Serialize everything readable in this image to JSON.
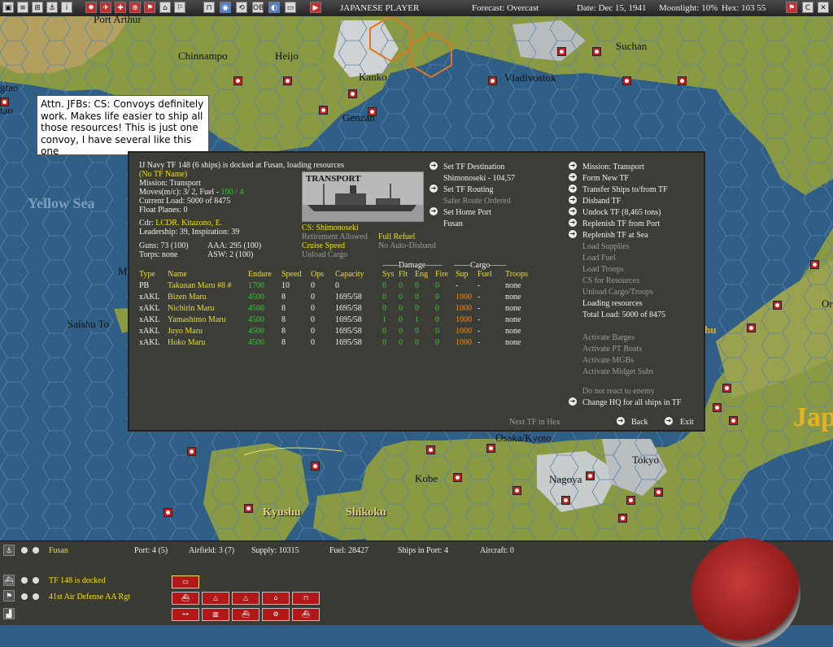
{
  "toolbar": {
    "player": "JAPANESE PLAYER",
    "forecast": "Forecast: Overcast",
    "date": "Date: Dec 15, 1941",
    "moonlight": "Moonlight: 10%",
    "hex": "Hex: 103 55",
    "icons": [
      "map-icon",
      "report-icon",
      "group-icon",
      "ship-icon",
      "info-icon",
      "flag-icon",
      "plane-icon",
      "unit-icon",
      "target-icon",
      "weather-icon",
      "base-icon",
      "globe-icon",
      "replay-icon",
      "ob-icon",
      "save-icon",
      "play-icon"
    ],
    "right_icons": [
      "map-toggle-icon",
      "c-icon",
      "x-icon"
    ]
  },
  "map_labels": {
    "port_arthur": "Port Arthur",
    "chinnampo": "Chinnampo",
    "heijo": "Heijo",
    "kanko": "Kanko",
    "suchan": "Suchan",
    "vladivostok": "Vladivostok",
    "genzan": "Genzan",
    "tao": "gtao",
    "tao2": "tao",
    "yellow_sea": "Yellow Sea",
    "saishu_to": "Saishu To",
    "osaka": "Osaka/Kyoto",
    "kobe": "Kobe",
    "nagoya": "Nagoya",
    "tokyo": "Tokyo",
    "kyushu": "Kyushu",
    "shikoku": "Shikoku",
    "japan": "Jap",
    "m": "M",
    "hu": "hu",
    "or": "Or"
  },
  "note": "Attn. JFBs:   CS: Convoys definitely work.  Makes life easier to ship all those resources!  This is just one convoy, I have several like this one",
  "tf": {
    "header": "IJ Navy TF 148 (6 ships) is docked at Fusan, loading resources",
    "no_tf_name": "(No TF Name)",
    "mission": "Mission:  Transport",
    "moves_label": "Moves(m/c): 3/ 2, Fuel - ",
    "moves_fuel": "100 / 4",
    "current_load": "Current Load:  5000 of 8475",
    "float_planes": "Float Planes: 0",
    "cdr_label": "Cdr:  ",
    "cdr_name": "LCDR. Kitazono, E.",
    "leadership": "Leadership: 39, Inspiration: 39",
    "guns": "Guns: 73 (100)",
    "aaa": "AAA: 295 (100)",
    "torps": "Torps: none",
    "asw": "ASW: 2 (100)",
    "photo_label": "TRANSPORT",
    "cs": "CS: Shimonoseki",
    "retirement": "Retirement Allowed",
    "full_refuel": "Full Refuel",
    "cruise_speed": "Cruise Speed",
    "no_auto_disband": "No Auto-Disband",
    "unload_cargo": "Unload Cargo"
  },
  "middle_menu": {
    "set_destination": "Set TF Destination",
    "destination_value": "Shimonoseki - 104,57",
    "set_routing": "Set TF Routing",
    "routing_value": "Safer Route Ordered",
    "set_home": "Set Home Port",
    "home_value": "Fusan"
  },
  "right_menu": {
    "mission": "Mission: Transport",
    "form_new": "Form New TF",
    "transfer": "Transfer Ships to/from TF",
    "disband": "Disband TF",
    "undock": "Undock TF (8,465 tons)",
    "replenish_port": "Replenish TF from Port",
    "replenish_sea": "Replenish TF at Sea",
    "load_supplies": "Load Supplies",
    "load_fuel": "Load Fuel",
    "load_troops": "Load Troops",
    "cs_resources": "CS for Resources",
    "unload": "Unload Cargo/Troops",
    "loading_resources": "Loading resources",
    "total_load": "Total Load: 5000 of 8475",
    "barges": "Activate Barges",
    "pt_boats": "Activate PT Boats",
    "mgbs": "Activate MGBs",
    "midget": "Activate Midget Subs",
    "no_react": "Do not react to enemy",
    "change_hq": "Change HQ for all ships in TF",
    "next_tf": "Next TF in Hex",
    "back": "Back",
    "exit": "Exit"
  },
  "ship_table": {
    "group_damage": "Damage",
    "group_cargo": "Cargo",
    "headers": [
      "Type",
      "Name",
      "Endure",
      "Speed",
      "Ops",
      "Capacity",
      "Sys",
      "Flt",
      "Eng",
      "Fire",
      "Sup",
      "Fuel",
      "Troops"
    ],
    "rows": [
      [
        "PB",
        "Takunan Maru #8 #",
        "1700",
        "10",
        "0",
        "0",
        "0",
        "0",
        "0",
        "0",
        "-",
        "-",
        "none"
      ],
      [
        "xAKL",
        "Bizen Maru",
        "4500",
        "8",
        "0",
        "1695/58",
        "0",
        "0",
        "0",
        "0",
        "1000",
        "-",
        "none"
      ],
      [
        "xAKL",
        "Nichirin Maru",
        "4500",
        "8",
        "0",
        "1695/58",
        "0",
        "0",
        "0",
        "0",
        "1000",
        "-",
        "none"
      ],
      [
        "xAKL",
        "Yamashimo Maru",
        "4500",
        "8",
        "0",
        "1695/58",
        "1",
        "0",
        "1",
        "0",
        "1000",
        "-",
        "none"
      ],
      [
        "xAKL",
        "Juyo Maru",
        "4500",
        "8",
        "0",
        "1695/58",
        "0",
        "0",
        "0",
        "0",
        "1000",
        "-",
        "none"
      ],
      [
        "xAKL",
        "Hoko Maru",
        "4500",
        "8",
        "0",
        "1695/58",
        "0",
        "0",
        "0",
        "0",
        "1000",
        "-",
        "none"
      ]
    ]
  },
  "bottom": {
    "base_name": "Fusan",
    "port": "Port: 4 (5)",
    "airfield": "Airfield: 3 (7)",
    "supply": "Supply: 10315",
    "fuel": "Fuel: 28427",
    "ships_in_port": "Ships in Port: 4",
    "aircraft": "Aircraft: 0",
    "tf_status": "TF 148 is docked",
    "unit": "41st Air Defense AA Rgt"
  },
  "colors": {
    "sea": "#2f5f86",
    "land": "#8a9a42",
    "panel": "#3c3d37",
    "yellow": "#eee000",
    "green": "#2fcc3a",
    "orange": "#ff8a00"
  }
}
